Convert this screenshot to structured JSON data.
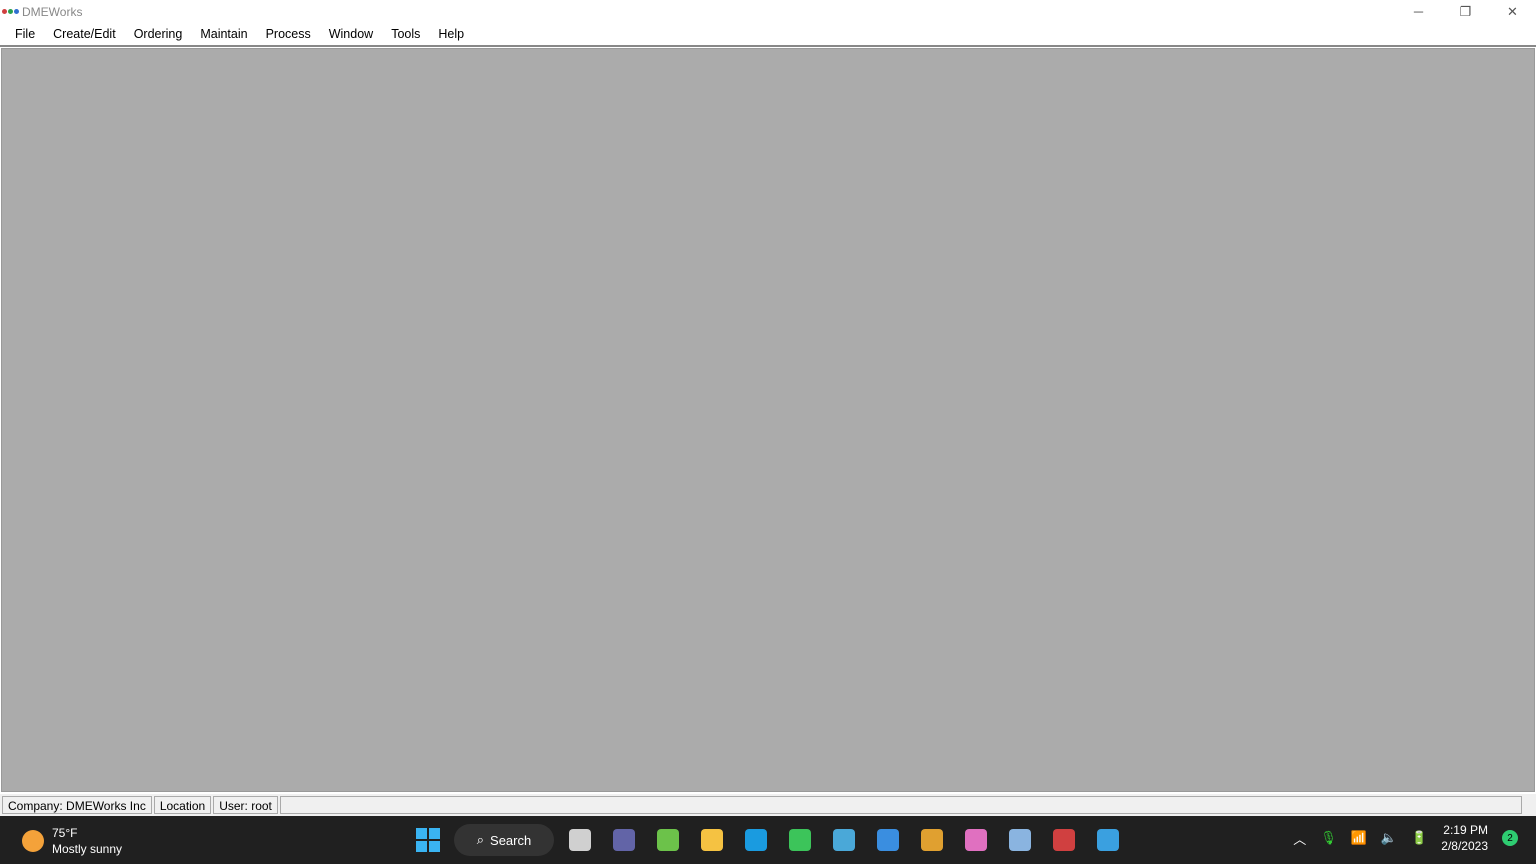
{
  "window": {
    "title": "DMEWorks",
    "minimize": "─",
    "restore": "❐",
    "close": "✕"
  },
  "menu": [
    "File",
    "Create/Edit",
    "Ordering",
    "Maintain",
    "Process",
    "Window",
    "Tools",
    "Help"
  ],
  "status": {
    "company": "Company: DMEWorks Inc",
    "location": "Location",
    "user": "User: root"
  },
  "taskbar": {
    "temp": "75°F",
    "weather": "Mostly sunny",
    "search": "Search",
    "time": "2:19 PM",
    "date": "2/8/2023",
    "notifications": "2",
    "apps": [
      {
        "name": "task-view",
        "color": "#d0d0d0"
      },
      {
        "name": "teams",
        "color": "#6264a7"
      },
      {
        "name": "sheets",
        "color": "#6cc24a"
      },
      {
        "name": "file-explorer",
        "color": "#f5c242"
      },
      {
        "name": "edge",
        "color": "#1a9be0"
      },
      {
        "name": "app-green",
        "color": "#3cc45a"
      },
      {
        "name": "app-bird",
        "color": "#4aa8d8"
      },
      {
        "name": "app-bolt",
        "color": "#3a8ee0"
      },
      {
        "name": "chrome",
        "color": "#e0a030"
      },
      {
        "name": "app-flower",
        "color": "#e070c0"
      },
      {
        "name": "monitor",
        "color": "#8ab4e0"
      },
      {
        "name": "dmeworks",
        "color": "#d04040"
      },
      {
        "name": "app-circle",
        "color": "#3aa0e0"
      }
    ]
  }
}
